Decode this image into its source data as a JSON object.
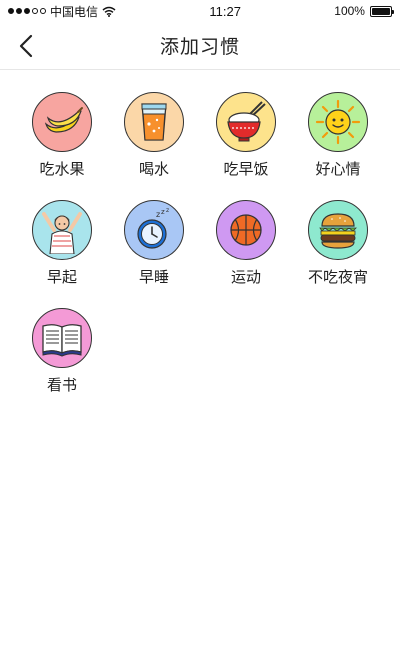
{
  "status_bar": {
    "carrier": "中国电信",
    "time": "11:27",
    "battery": "100%"
  },
  "nav": {
    "title": "添加习惯"
  },
  "colors": {
    "fruit": "#f7a5a0",
    "water": "#fbd7a8",
    "breakfast": "#fde38c",
    "mood": "#b7f09a",
    "wake": "#a9e4ec",
    "sleep": "#a9c7f5",
    "sport": "#cf99f2",
    "no_snack": "#8ee9cf",
    "read": "#f49ad6"
  },
  "habits": [
    {
      "label": "吃水果",
      "icon": "banana-icon",
      "color": "#f7a5a0"
    },
    {
      "label": "喝水",
      "icon": "water-glass-icon",
      "color": "#fbd7a8"
    },
    {
      "label": "吃早饭",
      "icon": "rice-bowl-icon",
      "color": "#fde38c"
    },
    {
      "label": "好心情",
      "icon": "sun-icon",
      "color": "#b7f09a"
    },
    {
      "label": "早起",
      "icon": "stretching-person-icon",
      "color": "#a9e4ec"
    },
    {
      "label": "早睡",
      "icon": "alarm-clock-icon",
      "color": "#a9c7f5"
    },
    {
      "label": "运动",
      "icon": "basketball-icon",
      "color": "#cf99f2"
    },
    {
      "label": "不吃夜宵",
      "icon": "burger-icon",
      "color": "#8ee9cf"
    },
    {
      "label": "看书",
      "icon": "book-icon",
      "color": "#f49ad6"
    }
  ]
}
